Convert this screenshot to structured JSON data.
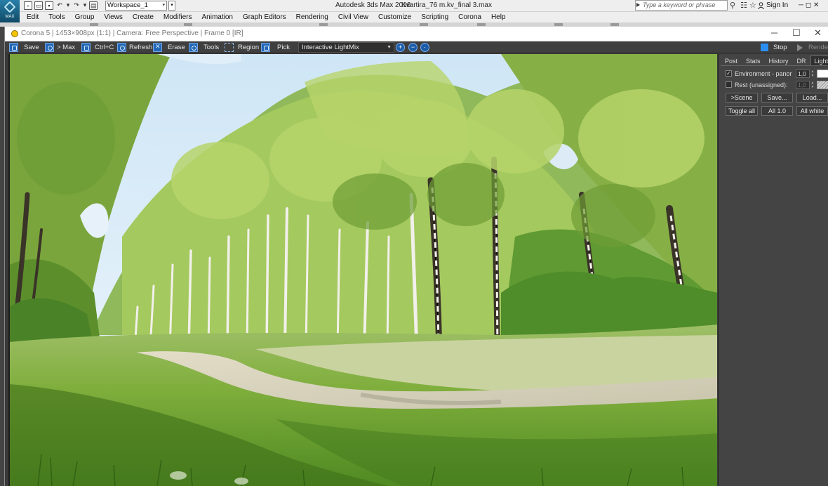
{
  "app": {
    "title": "Autodesk 3ds Max 2016",
    "file_name": "Kvartira_76 m.kv_final 3.max",
    "logo_label": "MAX",
    "workspace": "Workspace_1",
    "search_placeholder": "Type a keyword or phrase",
    "sign_in": "Sign In",
    "window_controls": "─ ◻ ✕"
  },
  "menu": [
    "Edit",
    "Tools",
    "Group",
    "Views",
    "Create",
    "Modifiers",
    "Animation",
    "Graph Editors",
    "Rendering",
    "Civil View",
    "Customize",
    "Scripting",
    "Corona",
    "Help"
  ],
  "vfb": {
    "title": "Corona 5 | 1453×908px (1:1) | Camera: Free Perspective | Frame 0 [IR]",
    "controls": {
      "minimize": "─",
      "maximize": "☐",
      "close": "✕"
    },
    "toolbar": {
      "save": "Save",
      "to_max": "> Max",
      "copy": "Ctrl+C",
      "refresh": "Refresh",
      "erase": "Erase",
      "tools": "Tools",
      "region": "Region",
      "pick": "Pick",
      "channel": "Interactive LightMix",
      "stop": "Stop",
      "render": "Render"
    },
    "panel": {
      "tabs": [
        "Post",
        "Stats",
        "History",
        "DR",
        "LightMix"
      ],
      "active_tab": "LightMix",
      "lightmix_rows": [
        {
          "checked": true,
          "label": "Environment - panorama",
          "value": "1,0",
          "color": "#ffffff",
          "enabled": true
        },
        {
          "checked": false,
          "label": "Rest (unassigned):",
          "value": "1,0",
          "color": "hatched",
          "enabled": false
        }
      ],
      "buttons_row1": [
        ">Scene",
        "Save...",
        "Load..."
      ],
      "buttons_row2": [
        "Toggle all",
        "All 1.0",
        "All white"
      ]
    }
  }
}
